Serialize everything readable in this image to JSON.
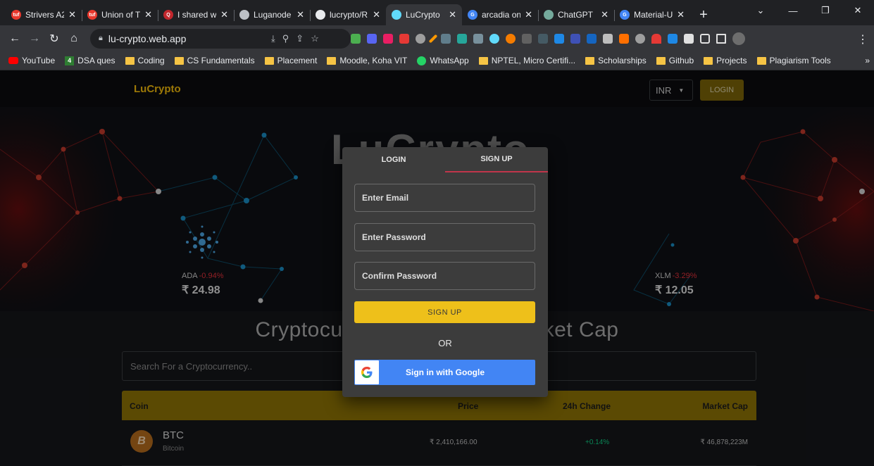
{
  "browser": {
    "tabs": [
      {
        "title": "Strivers A2",
        "favicon_color": "#e8382d",
        "favicon_text": "tuf"
      },
      {
        "title": "Union of T",
        "favicon_color": "#e8382d",
        "favicon_text": "tuf"
      },
      {
        "title": "I shared w",
        "favicon_color": "#c2272d",
        "favicon_text": "Q"
      },
      {
        "title": "Luganode",
        "favicon_color": "#bdc1c6",
        "favicon_text": ""
      },
      {
        "title": "lucrypto/R",
        "favicon_color": "#e8eaed",
        "favicon_text": ""
      },
      {
        "title": "LuCrypto",
        "favicon_color": "#61dafb",
        "favicon_text": ""
      },
      {
        "title": "arcadia on",
        "favicon_color": "#4285f4",
        "favicon_text": "G"
      },
      {
        "title": "ChatGPT",
        "favicon_color": "#74aa9c",
        "favicon_text": ""
      },
      {
        "title": "Material-U",
        "favicon_color": "#4285f4",
        "favicon_text": "G"
      }
    ],
    "active_tab_index": 5,
    "new_tab_label": "+",
    "url": "lu-crypto.web.app",
    "bookmarks": [
      {
        "label": "YouTube",
        "type": "youtube"
      },
      {
        "label": "DSA ques",
        "type": "green4"
      },
      {
        "label": "Coding",
        "type": "folder"
      },
      {
        "label": "CS Fundamentals",
        "type": "folder"
      },
      {
        "label": "Placement",
        "type": "folder"
      },
      {
        "label": "Moodle, Koha VIT",
        "type": "folder"
      },
      {
        "label": "WhatsApp",
        "type": "whatsapp"
      },
      {
        "label": "NPTEL, Micro Certifi...",
        "type": "folder"
      },
      {
        "label": "Scholarships",
        "type": "folder"
      },
      {
        "label": "Github",
        "type": "folder"
      },
      {
        "label": "Projects",
        "type": "folder"
      },
      {
        "label": "Plagiarism Tools",
        "type": "folder"
      }
    ],
    "bookmark_badge_text": "4"
  },
  "app": {
    "logo": "LuCrypto",
    "currency": "INR",
    "login_button": "LOGIN",
    "banner_title": "LuCrypto",
    "trending": [
      {
        "symbol": "ADA",
        "change": "-0.94%",
        "price": "₹ 24.98"
      },
      {
        "symbol": "XLM",
        "change": "-3.29%",
        "price": "₹ 12.05"
      }
    ],
    "section_title": "Cryptocurrency Prices by Market Cap",
    "search_placeholder": "Search For a Cryptocurrency..",
    "table": {
      "headers": [
        "Coin",
        "Price",
        "24h Change",
        "Market Cap"
      ],
      "rows": [
        {
          "symbol": "BTC",
          "name": "Bitcoin",
          "price": "₹ 2,410,166.00",
          "change": "+0.14%",
          "market_cap": "₹ 46,878,223M"
        }
      ]
    }
  },
  "modal": {
    "tabs": [
      "LOGIN",
      "SIGN UP"
    ],
    "active_tab": 1,
    "email_placeholder": "Enter Email",
    "password_placeholder": "Enter Password",
    "confirm_placeholder": "Confirm Password",
    "signup_button": "SIGN UP",
    "or_text": "OR",
    "google_button": "Sign in with Google"
  },
  "colors": {
    "accent": "#f0b90b",
    "positive": "#0ecb81",
    "negative": "#e0313a",
    "google_blue": "#4285f4"
  }
}
